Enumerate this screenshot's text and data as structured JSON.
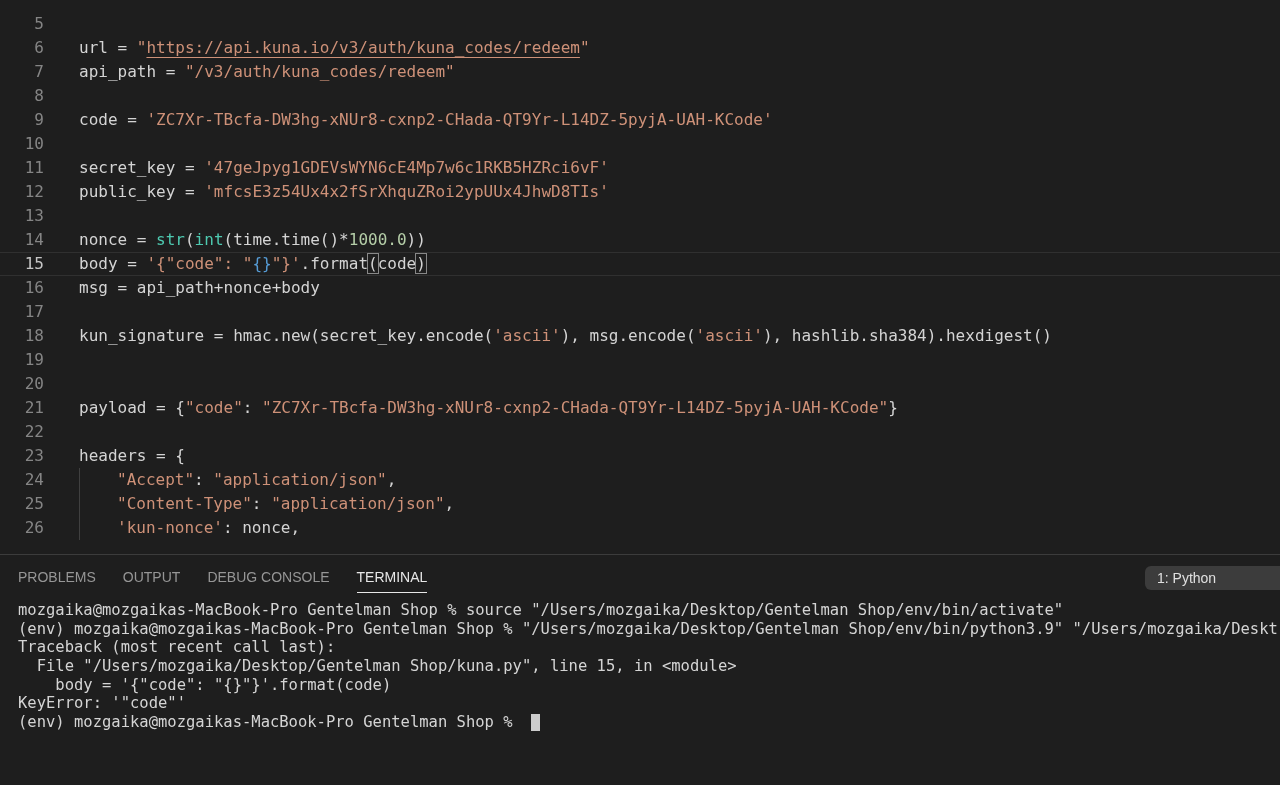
{
  "editor": {
    "lines": [
      {
        "number": "5",
        "current": false
      },
      {
        "number": "6",
        "current": false,
        "tokens": [
          {
            "text": "url = \"",
            "kind": "plainstr"
          },
          {
            "text": "https://api.kuna.io/v3/auth/kuna_codes/redeem",
            "kind": "link"
          },
          {
            "text": "\"",
            "kind": "string"
          }
        ]
      },
      {
        "number": "7",
        "current": false,
        "tokens": [
          {
            "text": "api_path = ",
            "kind": "plain"
          },
          {
            "text": "\"/v3/auth/kuna_codes/redeem\"",
            "kind": "string"
          }
        ]
      },
      {
        "number": "8",
        "current": false
      },
      {
        "number": "9",
        "current": false,
        "tokens": [
          {
            "text": "code = ",
            "kind": "plain"
          },
          {
            "text": "'ZC7Xr-TBcfa-DW3hg-xNUr8-cxnp2-CHada-QT9Yr-L14DZ-5pyjA-UAH-KCode'",
            "kind": "string"
          }
        ]
      },
      {
        "number": "10",
        "current": false
      },
      {
        "number": "11",
        "current": false,
        "tokens": [
          {
            "text": "secret_key = ",
            "kind": "plain"
          },
          {
            "text": "'47geJpyg1GDEVsWYN6cE4Mp7w6c1RKB5HZRci6vF'",
            "kind": "string"
          }
        ]
      },
      {
        "number": "12",
        "current": false,
        "tokens": [
          {
            "text": "public_key = ",
            "kind": "plain"
          },
          {
            "text": "'mfcsE3z54Ux4x2fSrXhquZRoi2ypUUx4JhwD8TIs'",
            "kind": "string"
          }
        ]
      },
      {
        "number": "13",
        "current": false
      },
      {
        "number": "14",
        "current": false,
        "tokens": [
          {
            "text": "nonce = ",
            "kind": "plain"
          },
          {
            "text": "str",
            "kind": "builtin"
          },
          {
            "text": "(",
            "kind": "plain"
          },
          {
            "text": "int",
            "kind": "builtin"
          },
          {
            "text": "(time.time()*",
            "kind": "plain"
          },
          {
            "text": "1000.0",
            "kind": "number"
          },
          {
            "text": "))",
            "kind": "plain"
          }
        ]
      },
      {
        "number": "15",
        "current": true,
        "tokens": [
          {
            "text": "body = ",
            "kind": "plain"
          },
          {
            "text": "'{\"code\": \"",
            "kind": "string"
          },
          {
            "text": "{}",
            "kind": "placeholder"
          },
          {
            "text": "\"}'",
            "kind": "string"
          },
          {
            "text": ".format",
            "kind": "plain"
          },
          {
            "text": "(",
            "kind": "match"
          },
          {
            "text": "code",
            "kind": "plain"
          },
          {
            "text": ")",
            "kind": "match"
          }
        ]
      },
      {
        "number": "16",
        "current": false,
        "tokens": [
          {
            "text": "msg = api_path+nonce+body",
            "kind": "plain"
          }
        ]
      },
      {
        "number": "17",
        "current": false
      },
      {
        "number": "18",
        "current": false,
        "tokens": [
          {
            "text": "kun_signature = hmac.new(secret_key.encode(",
            "kind": "plain"
          },
          {
            "text": "'ascii'",
            "kind": "string"
          },
          {
            "text": "), msg.encode(",
            "kind": "plain"
          },
          {
            "text": "'ascii'",
            "kind": "string"
          },
          {
            "text": "), hashlib.sha384).hexdigest()",
            "kind": "plain"
          }
        ]
      },
      {
        "number": "19",
        "current": false
      },
      {
        "number": "20",
        "current": false
      },
      {
        "number": "21",
        "current": false,
        "tokens": [
          {
            "text": "payload = {",
            "kind": "plain"
          },
          {
            "text": "\"code\"",
            "kind": "string"
          },
          {
            "text": ": ",
            "kind": "plain"
          },
          {
            "text": "\"ZC7Xr-TBcfa-DW3hg-xNUr8-cxnp2-CHada-QT9Yr-L14DZ-5pyjA-UAH-KCode\"",
            "kind": "string"
          },
          {
            "text": "}",
            "kind": "plain"
          }
        ]
      },
      {
        "number": "22",
        "current": false
      },
      {
        "number": "23",
        "current": false,
        "tokens": [
          {
            "text": "headers = {",
            "kind": "plain"
          }
        ]
      },
      {
        "number": "24",
        "current": false,
        "guide": true,
        "tokens": [
          {
            "text": "\"Accept\"",
            "kind": "string"
          },
          {
            "text": ": ",
            "kind": "plain"
          },
          {
            "text": "\"application/json\"",
            "kind": "string"
          },
          {
            "text": ",",
            "kind": "plain"
          }
        ]
      },
      {
        "number": "25",
        "current": false,
        "guide": true,
        "tokens": [
          {
            "text": "\"Content-Type\"",
            "kind": "string"
          },
          {
            "text": ": ",
            "kind": "plain"
          },
          {
            "text": "\"application/json\"",
            "kind": "string"
          },
          {
            "text": ",",
            "kind": "plain"
          }
        ]
      },
      {
        "number": "26",
        "current": false,
        "guide": true,
        "tokens": [
          {
            "text": "'kun-nonce'",
            "kind": "string"
          },
          {
            "text": ": nonce,",
            "kind": "plain"
          }
        ]
      }
    ]
  },
  "panel": {
    "tabs": [
      {
        "label": "PROBLEMS",
        "selected": false
      },
      {
        "label": "OUTPUT",
        "selected": false
      },
      {
        "label": "DEBUG CONSOLE",
        "selected": false
      },
      {
        "label": "TERMINAL",
        "selected": true
      }
    ],
    "terminal_select": "1: Python",
    "terminal": {
      "lines": [
        "mozgaika@mozgaikas-MacBook-Pro Gentelman Shop % source \"/Users/mozgaika/Desktop/Gentelman Shop/env/bin/activate\"",
        "(env) mozgaika@mozgaikas-MacBook-Pro Gentelman Shop % \"/Users/mozgaika/Desktop/Gentelman Shop/env/bin/python3.9\" \"/Users/mozgaika/Deskt",
        "Traceback (most recent call last):",
        "  File \"/Users/mozgaika/Desktop/Gentelman Shop/kuna.py\", line 15, in <module>",
        "    body = '{\"code\": \"{}\"}'.format(code)",
        "KeyError: '\"code\"'",
        "(env) mozgaika@mozgaikas-MacBook-Pro Gentelman Shop % "
      ],
      "cursor": true
    }
  }
}
